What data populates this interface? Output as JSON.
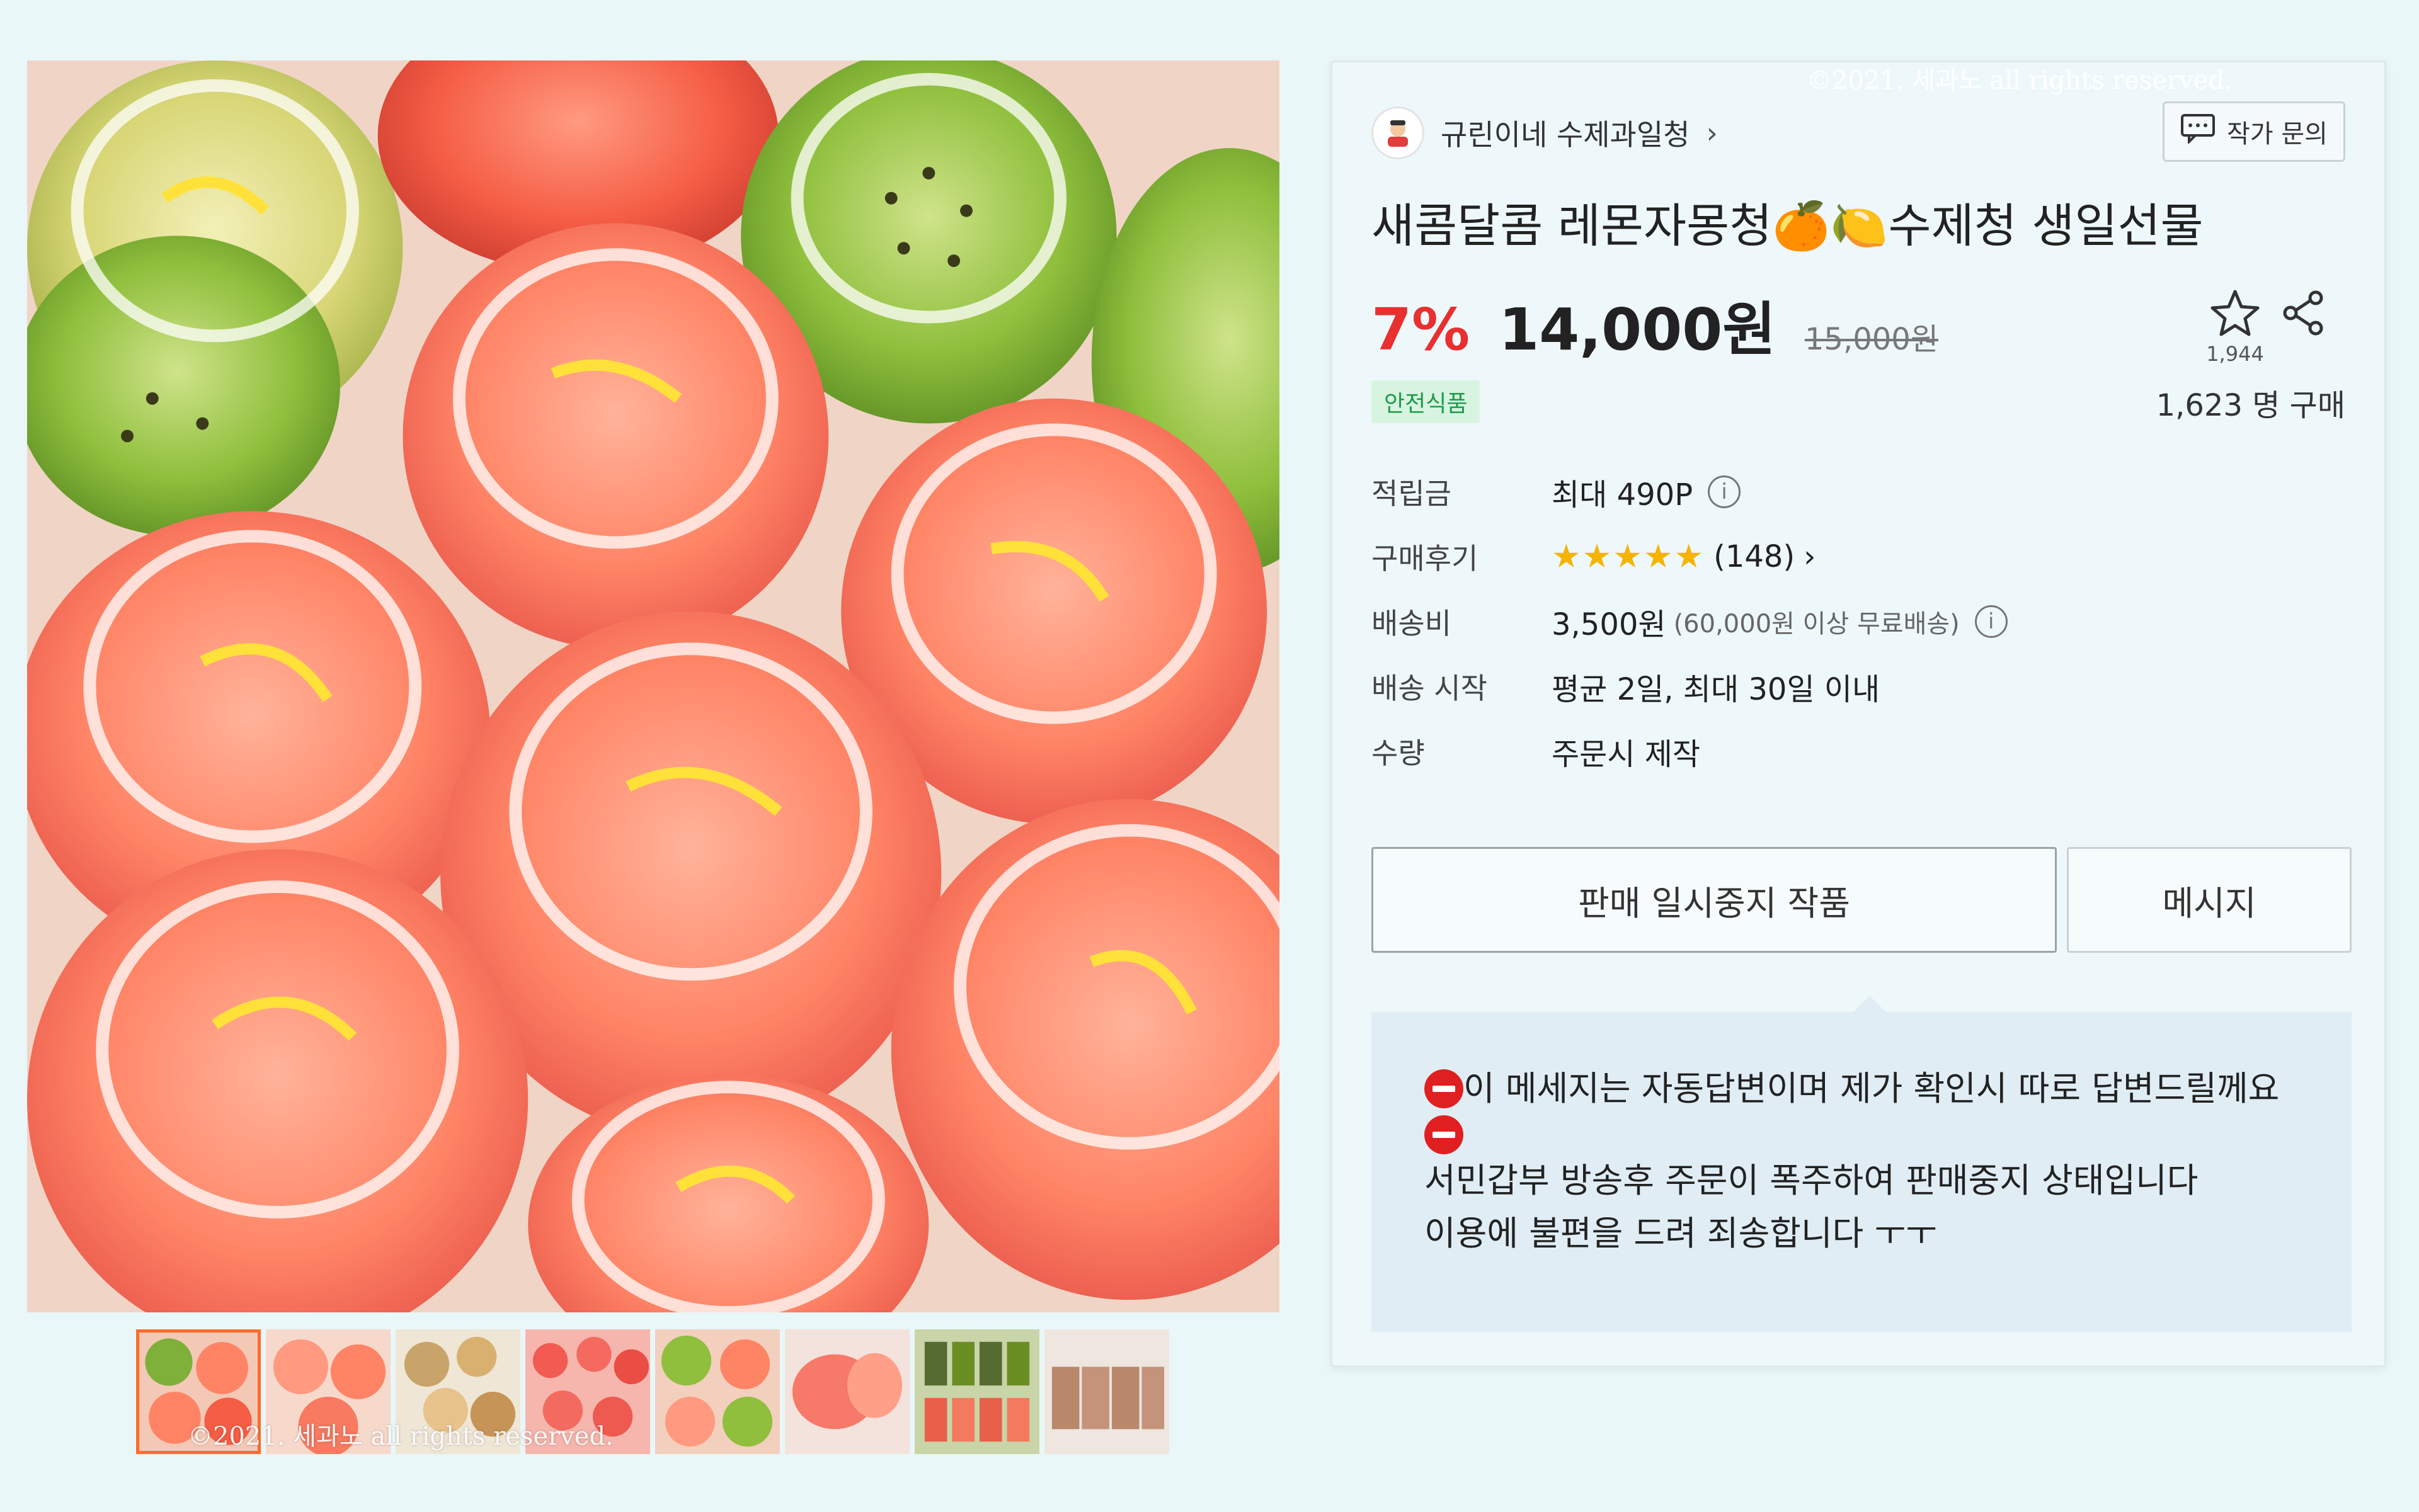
{
  "watermark": "©2021. 세과노 all rights reserved.",
  "shop": {
    "name": "규린이네 수제과일청",
    "chevron": "›",
    "inquiry_label": "작가 문의"
  },
  "product": {
    "title": "새콤달콤 레몬자몽청🍊🍋수제청 생일선물",
    "discount": "7%",
    "price": "14,000원",
    "original_price": "15,000원",
    "favorites_count": "1,944",
    "safe_badge": "안전식품",
    "buyers": "1,623 명 구매"
  },
  "info": {
    "points_label": "적립금",
    "points_value": "최대 490P",
    "review_label": "구매후기",
    "review_stars": "★★★★★",
    "review_count": "(148)",
    "review_chevron": "›",
    "shipping_label": "배송비",
    "shipping_value": "3,500원",
    "shipping_note": "(60,000원 이상 무료배송)",
    "start_label": "배송 시작",
    "start_value": "평균 2일, 최대 30일 이내",
    "qty_label": "수량",
    "qty_value": "주문시 제작",
    "info_glyph": "i"
  },
  "buttons": {
    "paused": "판매 일시중지 작품",
    "message": "메시지"
  },
  "notice": {
    "line1": "이 메세지는 자동답변이며 제가 확인시 따로 답변드릴께요",
    "line3": "서민갑부 방송후 주문이 폭주하여 판매중지 상태입니다",
    "line4": "이용에 불편을 드려 죄송합니다 ㅜㅜ"
  },
  "colors": {
    "background": "#e9f7f8",
    "discount_red": "#e8302f",
    "safe_green": "#1a9d4a",
    "star_yellow": "#f5b400",
    "selected_thumb_border": "#ff6a2a"
  },
  "icons": [
    "star-icon",
    "share-icon",
    "chat-icon",
    "info-icon",
    "no-entry-icon"
  ]
}
